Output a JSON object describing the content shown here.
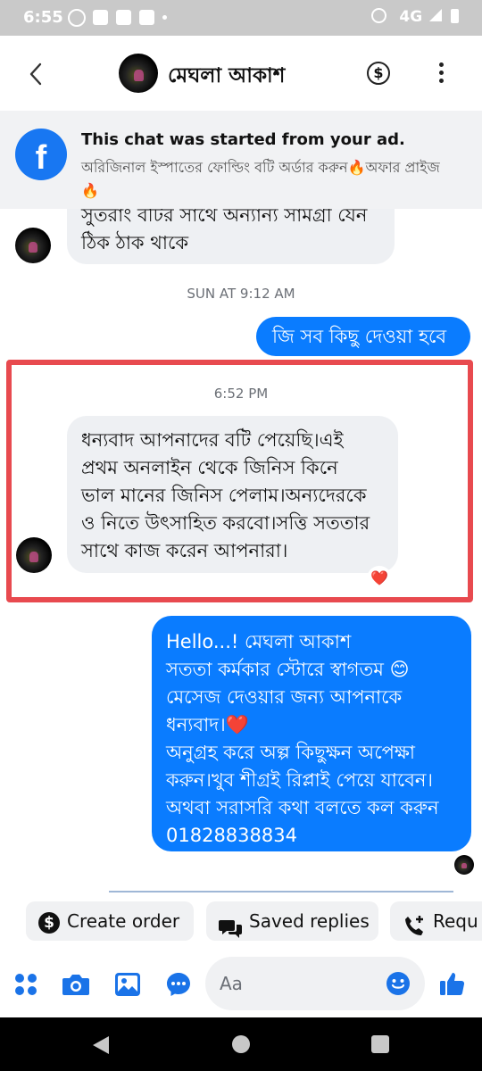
{
  "status_bar": {
    "time": "6:55",
    "network": "4G"
  },
  "header": {
    "contact_name": "মেঘলা আকাশ"
  },
  "ad_banner": {
    "title": "This chat was started from your ad.",
    "subtitle": "অরিজিনাল ইস্পাতের ফোল্ডিং বটি অর্ডার করুন🔥অফার প্রাইজ🔥"
  },
  "messages": {
    "partial_line1": "সুতরাং বটির সাথে অন্যান্য সামগ্রী যেন",
    "partial_line2": "ঠিক ঠাক থাকে",
    "timestamp1": "SUN AT 9:12 AM",
    "out1": "জি সব কিছু দেওয়া হবে",
    "timestamp2": "6:52 PM",
    "in2": [
      "ধন্যবাদ আপনাদের বটি পেয়েছি।এই",
      "প্রথম অনলাইন থেকে জিনিস কিনে",
      "ভাল মানের জিনিস পেলাম।অন্যদেরকে",
      "ও নিতে উৎসাহিত করবো।সত্তি সততার",
      "সাথে কাজ করেন আপনারা।"
    ],
    "in2_reaction": "❤️",
    "out2": [
      "Hello...! মেঘলা আকাশ",
      "সততা কর্মকার স্টোরে স্বাগতম 😊",
      "মেসেজ দেওয়ার জন্য আপনাকে",
      "ধন্যবাদ।❤️",
      "অনুগ্রহ করে অল্প কিছুক্ষন অপেক্ষা",
      "করুন।খুব শীগ্রই রিপ্লাই পেয়ে যাবেন।",
      "অথবা সরাসরি কথা বলতে কল করুন",
      "01828838834"
    ]
  },
  "quick_actions": {
    "create_order": "Create order",
    "saved_replies": "Saved replies",
    "request": "Requ"
  },
  "composer": {
    "placeholder": "Aa"
  },
  "colors": {
    "accent": "#0a7cff",
    "highlight_border": "#e84a4f",
    "reaction": "#e0245e"
  }
}
